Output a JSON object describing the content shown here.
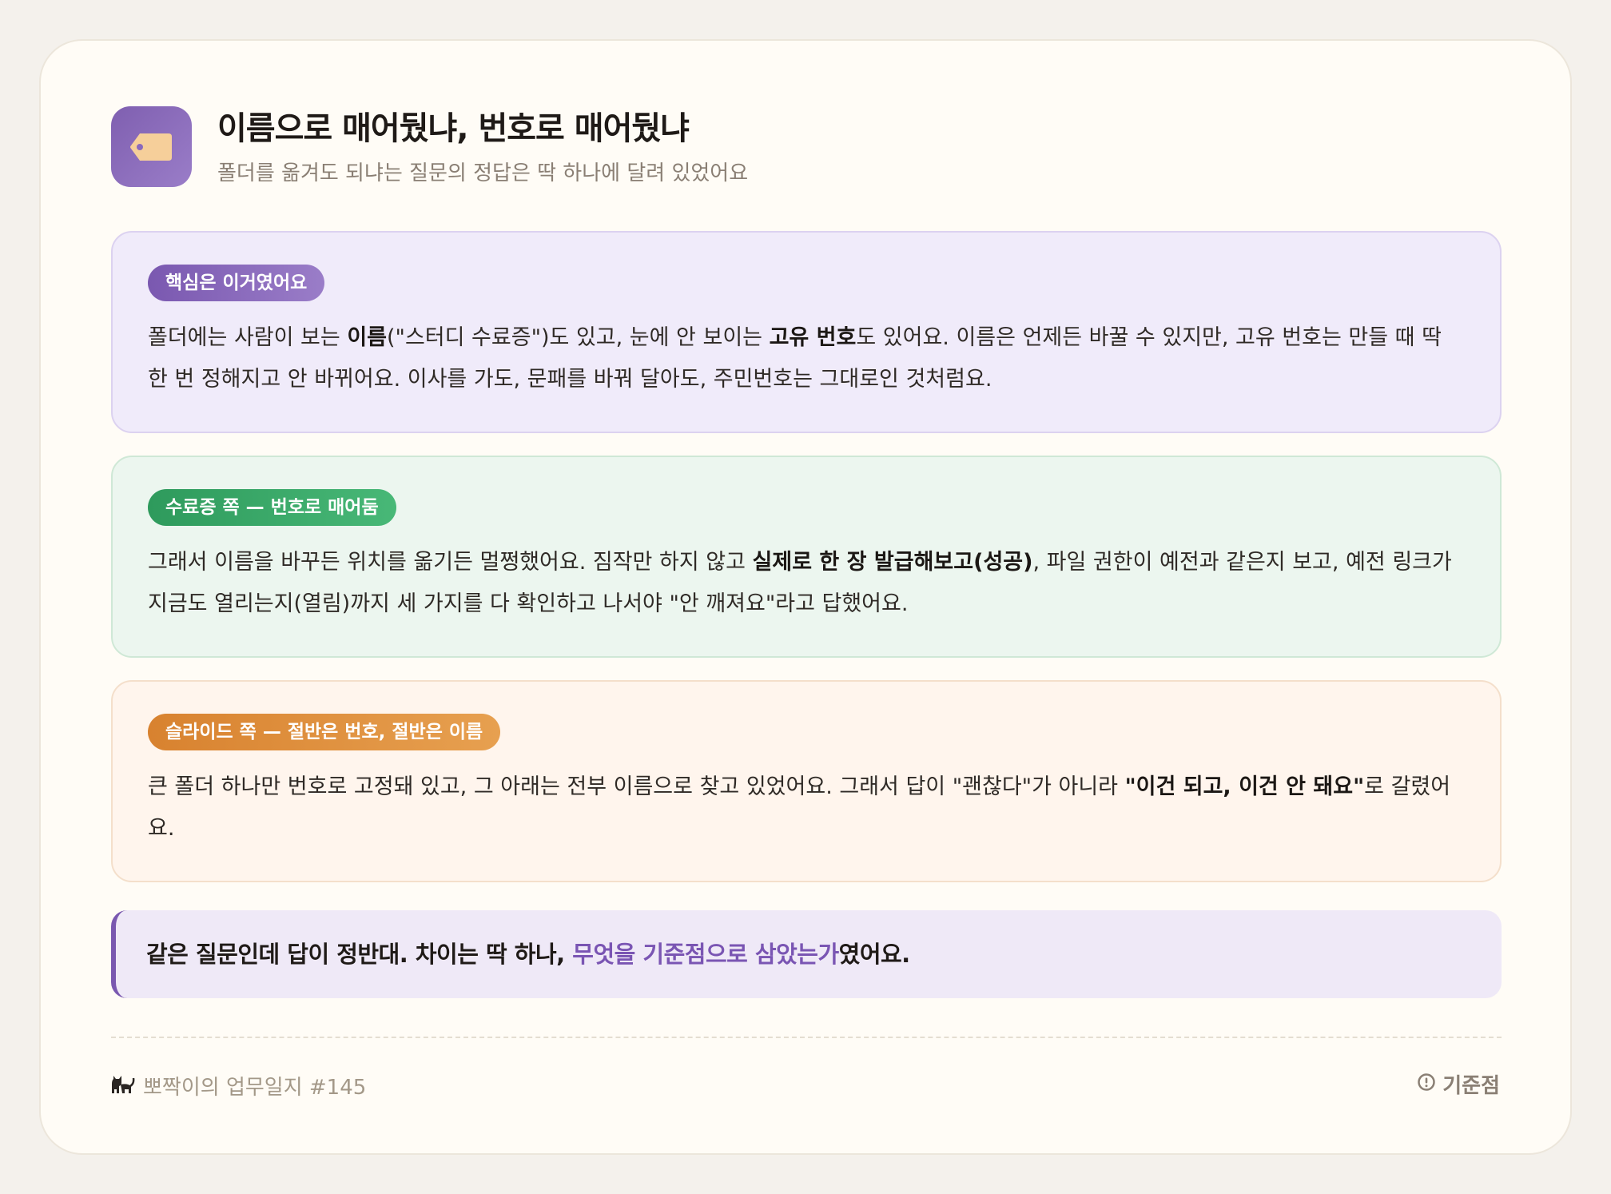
{
  "header": {
    "title": "이름으로 매어뒀냐, 번호로 매어뒀냐",
    "subtitle": "폴더를 옮겨도 되냐는 질문의 정답은 딱 하나에 달려 있었어요",
    "icon": "price-tag-icon"
  },
  "sections": [
    {
      "badge": "핵심은 이거였어요",
      "color": "#7a58b0",
      "segments": [
        "폴더에는 사람이 보는 ",
        "이름",
        "(\"스터디 수료증\")도 있고, 눈에 안 보이는 ",
        "고유 번호",
        "도 있어요. 이름은 언제든 바꿀 수 있지만, 고유 번호는 만들 때 딱 한 번 정해지고 안 바뀌어요. 이사를 가도, 문패를 바꿔 달아도, 주민번호는 그대로인 것처럼요."
      ]
    },
    {
      "badge": "수료증 쪽 — 번호로 매어둠",
      "color": "#2e9a5c",
      "segments": [
        "그래서 이름을 바꾸든 위치를 옮기든 멀쩡했어요. 짐작만 하지 않고 ",
        "실제로 한 장 발급해보고(성공)",
        ", 파일 권한이 예전과 같은지 보고, 예전 링크가 지금도 열리는지(열림)까지 세 가지를 다 확인하고 나서야 \"안 깨져요\"라고 답했어요."
      ]
    },
    {
      "badge": "슬라이드 쪽 — 절반은 번호, 절반은 이름",
      "color": "#d8822f",
      "segments": [
        "큰 폴더 하나만 번호로 고정돼 있고, 그 아래는 전부 이름으로 찾고 있었어요. 그래서 답이 \"괜찮다\"가 아니라 ",
        "\"이건 되고, 이건 안 돼요\"",
        "로 갈렸어요."
      ]
    }
  ],
  "callout": {
    "before": "같은 질문인데 답이 정반대. 차이는 딱 하나, ",
    "accent": "무엇을 기준점으로 삼았는가",
    "after": "였어요.",
    "accent_color": "#7a55b3"
  },
  "footer": {
    "left_icon": "cat-icon",
    "left_text": "뽀짝이의 업무일지 #145",
    "right_icon": "info-circle-icon",
    "right_text": "기준점"
  }
}
